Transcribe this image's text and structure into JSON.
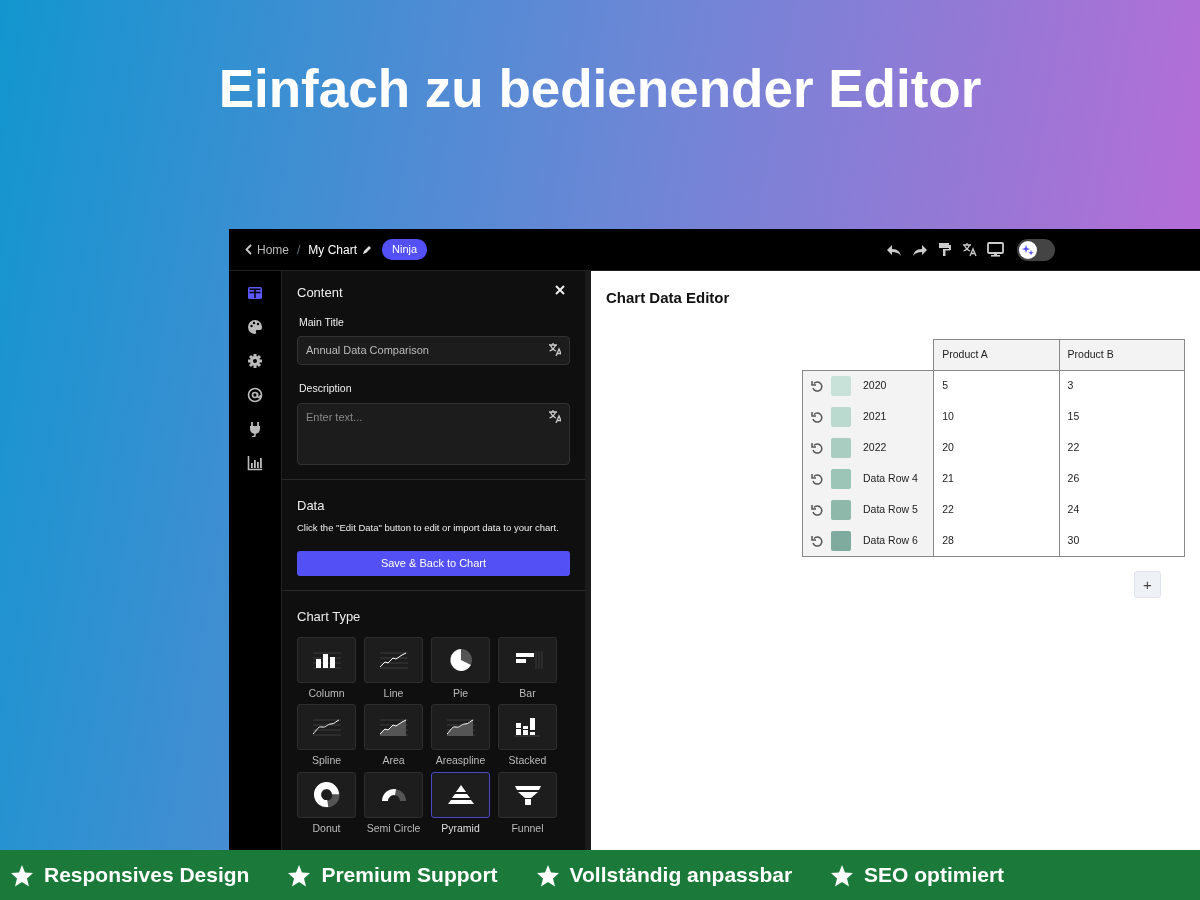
{
  "headline": "Einfach zu bedienender Editor",
  "topbar": {
    "back": "Home",
    "separator": "/",
    "chart_name": "My Chart",
    "badge": "Ninja",
    "ai_toggle": {
      "on": false
    }
  },
  "sidebar": {
    "items": [
      {
        "kind": "table",
        "selected": true
      },
      {
        "kind": "palette",
        "selected": false
      },
      {
        "kind": "gear",
        "selected": false
      },
      {
        "kind": "at",
        "selected": false
      },
      {
        "kind": "plug",
        "selected": false
      },
      {
        "kind": "chart",
        "selected": false
      }
    ]
  },
  "panel": {
    "content_title": "Content",
    "main_title_label": "Main Title",
    "main_title_value": "Annual Data Comparison",
    "description_label": "Description",
    "description_placeholder": "Enter text...",
    "data_title": "Data",
    "data_text": "Click the \"Edit Data\" button to edit or import data to your chart.",
    "save_button": "Save & Back to Chart",
    "chart_type_title": "Chart Type",
    "chart_types": [
      {
        "kind": "column",
        "label": "Column",
        "selected": false
      },
      {
        "kind": "line",
        "label": "Line",
        "selected": false
      },
      {
        "kind": "pie",
        "label": "Pie",
        "selected": false
      },
      {
        "kind": "bar",
        "label": "Bar",
        "selected": false
      },
      {
        "kind": "spline",
        "label": "Spline",
        "selected": false
      },
      {
        "kind": "area",
        "label": "Area",
        "selected": false
      },
      {
        "kind": "areaspline",
        "label": "Areaspline",
        "selected": false
      },
      {
        "kind": "stacked",
        "label": "Stacked",
        "selected": false
      },
      {
        "kind": "donut",
        "label": "Donut",
        "selected": false
      },
      {
        "kind": "semicircle",
        "label": "Semi Circle",
        "selected": false
      },
      {
        "kind": "pyramid",
        "label": "Pyramid",
        "selected": true
      },
      {
        "kind": "funnel",
        "label": "Funnel",
        "selected": false
      }
    ]
  },
  "editor": {
    "title": "Chart Data Editor",
    "columns": [
      "Product A",
      "Product B"
    ],
    "rows": [
      {
        "label": "2020",
        "color": "#c8e2da",
        "values": [
          "5",
          "3"
        ]
      },
      {
        "label": "2021",
        "color": "#badad0",
        "values": [
          "10",
          "15"
        ]
      },
      {
        "label": "2022",
        "color": "#aacdc2",
        "values": [
          "20",
          "22"
        ]
      },
      {
        "label": "Data Row 4",
        "color": "#9cc4b7",
        "values": [
          "21",
          "26"
        ]
      },
      {
        "label": "Data Row 5",
        "color": "#8db8aa",
        "values": [
          "22",
          "24"
        ]
      },
      {
        "label": "Data Row 6",
        "color": "#7eab9d",
        "values": [
          "28",
          "30"
        ]
      }
    ],
    "add_button": "+"
  },
  "features": [
    "Responsives Design",
    "Premium Support",
    "Vollständig anpassbar",
    "SEO optimiert"
  ]
}
